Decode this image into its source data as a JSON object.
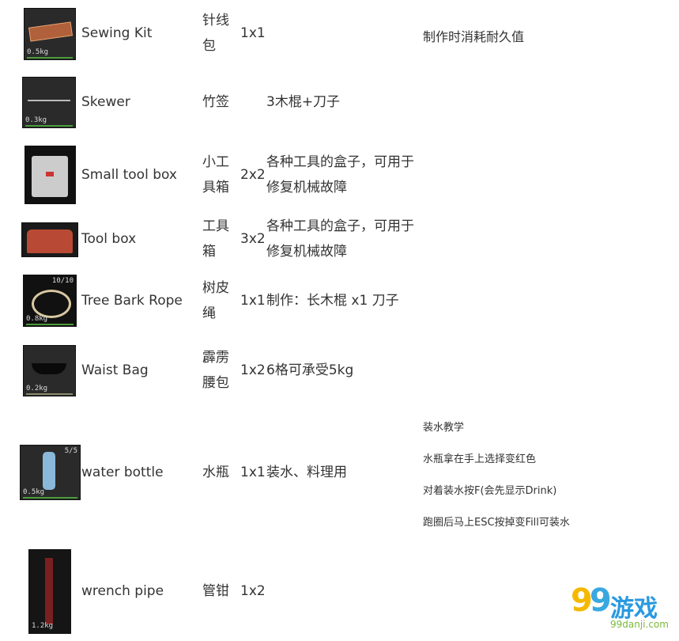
{
  "items": [
    {
      "en": "Sewing Kit",
      "cn": "针线包",
      "size": "1x1",
      "desc": "",
      "note": "制作时消耗耐久值",
      "weight": "0.5kg"
    },
    {
      "en": "Skewer",
      "cn": "竹签",
      "size": "",
      "desc": "3木棍+刀子",
      "weight": "0.3kg"
    },
    {
      "en": "Small tool box",
      "cn": "小工具箱",
      "size": "2x2",
      "desc": "各种工具的盒子，可用于修复机械故障",
      "weight": ""
    },
    {
      "en": "Tool box",
      "cn": "工具箱",
      "size": "3x2",
      "desc": "各种工具的盒子，可用于修复机械故障",
      "weight": ""
    },
    {
      "en": "Tree Bark Rope",
      "cn": "树皮绳",
      "size": "1x1",
      "desc": "制作：长木棍 x1 刀子",
      "weight": "0.8kg",
      "count": "10/10"
    },
    {
      "en": "Waist Bag",
      "cn": "霹雳腰包",
      "size": "1x2",
      "desc": "6格可承受5kg",
      "weight": "0.2kg"
    },
    {
      "en": "water bottle",
      "cn": "水瓶",
      "size": "1x1",
      "desc": "装水、料理用",
      "weight": "0.5kg",
      "count": "5/5",
      "notes": [
        "装水教学",
        "水瓶拿在手上选择变红色",
        "对着装水按F(会先显示Drink)",
        "跑圈后马上ESC按掉变Fill可装水"
      ]
    },
    {
      "en": "wrench pipe",
      "cn": "管钳",
      "size": "1x2",
      "desc": "",
      "weight": "1.2kg"
    }
  ],
  "logo": {
    "text": "99游戏",
    "sub": "99danji.com"
  }
}
